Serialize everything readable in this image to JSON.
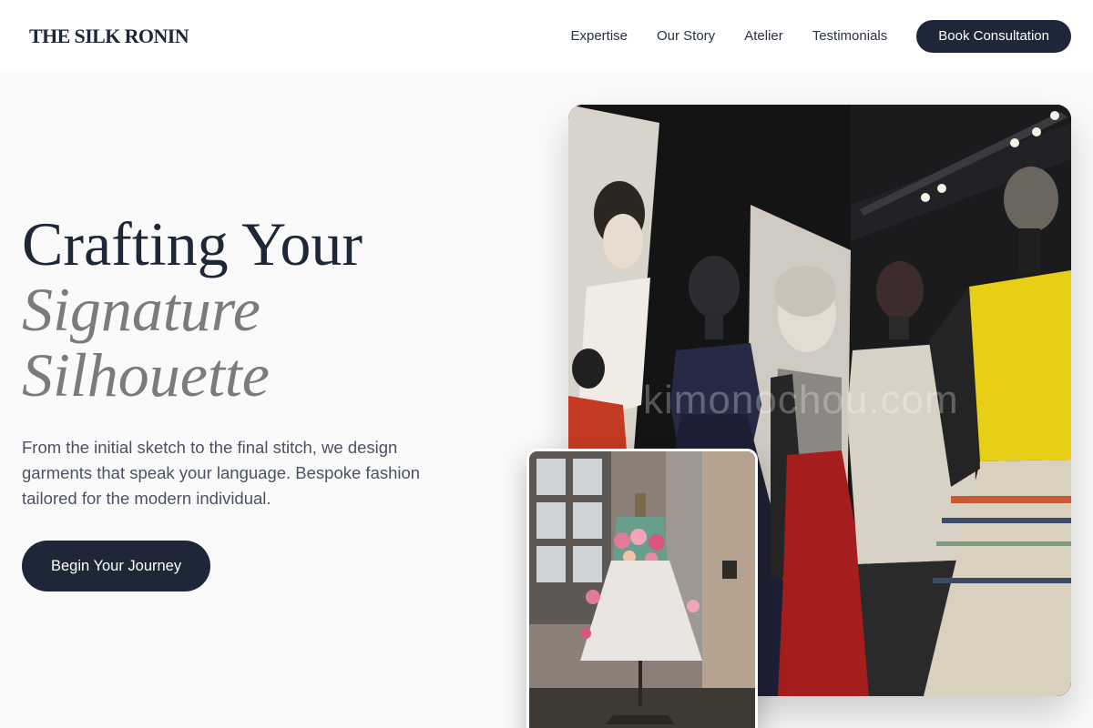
{
  "header": {
    "logo": "THE SILK RONIN",
    "nav": [
      "Expertise",
      "Our Story",
      "Atelier",
      "Testimonials"
    ],
    "cta": "Book Consultation"
  },
  "hero": {
    "headline_line1": "Crafting Your",
    "headline_line2": "Signature",
    "headline_line3": "Silhouette",
    "subtext": "From the initial sketch to the final stitch, we design garments that speak your language. Bespoke fashion tailored for the modern individual.",
    "button": "Begin Your Journey"
  },
  "images": {
    "main_watermark": "kimonochou.com"
  }
}
